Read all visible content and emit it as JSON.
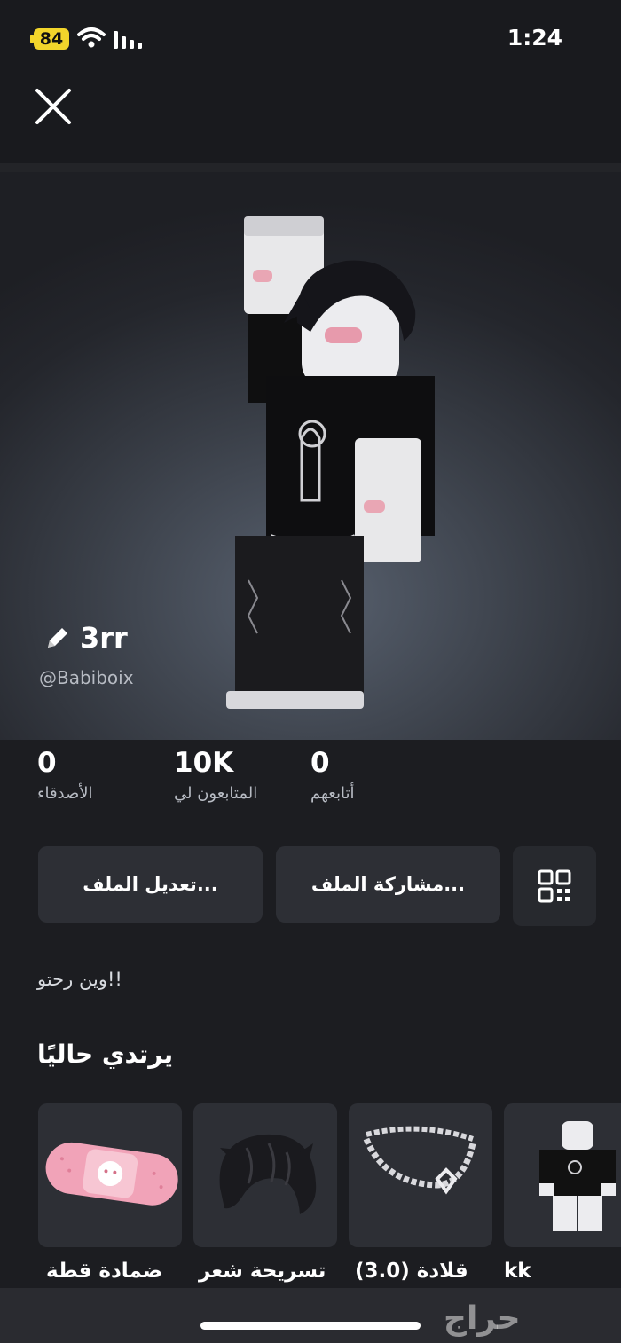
{
  "status_bar": {
    "battery": "84",
    "time": "1:24"
  },
  "profile": {
    "display_name": "3rr",
    "username": "@Babiboix",
    "bio": "وين رحتو!!"
  },
  "stats": [
    {
      "value": "0",
      "label": "أتابعهم"
    },
    {
      "value": "10K",
      "label": "المتابعون لي"
    },
    {
      "value": "0",
      "label": "الأصدقاء"
    }
  ],
  "actions": {
    "share_label": "مشاركة الملف...",
    "edit_label": "تعديل الملف..."
  },
  "wearing": {
    "title": "يرتدي حاليًا",
    "items": [
      {
        "name": "kk"
      },
      {
        "name": "قلادة (3.0)"
      },
      {
        "name": "تسريحة شعر"
      },
      {
        "name": "ضمادة قطة"
      }
    ]
  },
  "watermark": "حراج",
  "icons": [
    "close-icon",
    "pencil-icon",
    "qr-code-icon",
    "wifi-icon",
    "signal-icon"
  ]
}
